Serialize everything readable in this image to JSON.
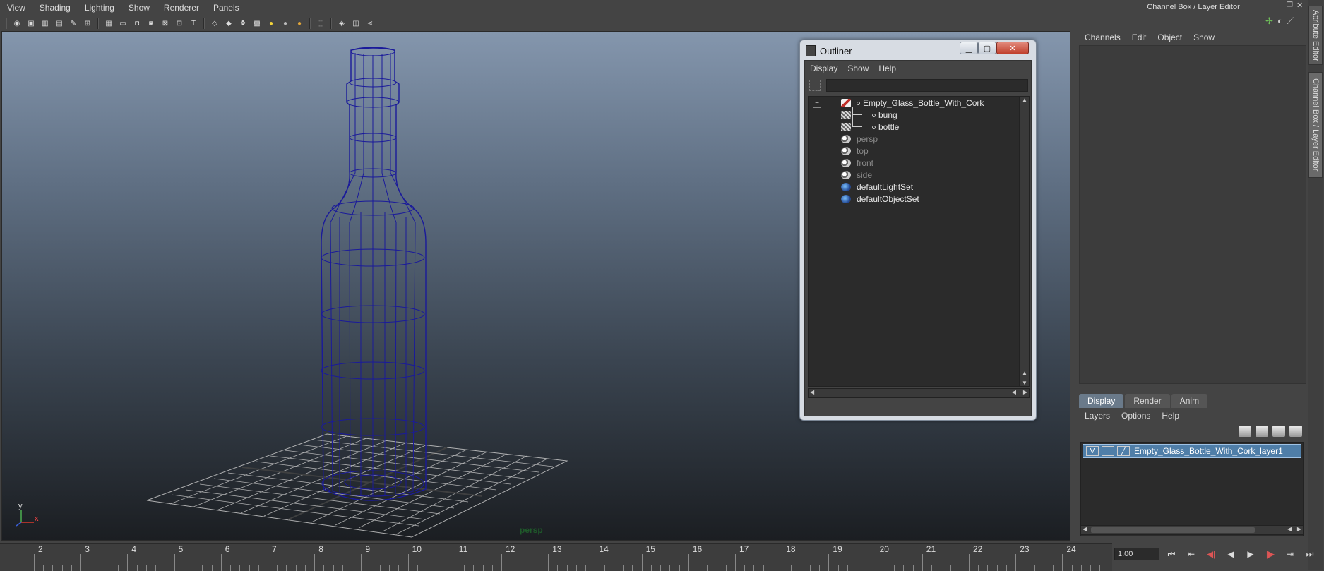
{
  "viewport": {
    "menu": [
      "View",
      "Shading",
      "Lighting",
      "Show",
      "Renderer",
      "Panels"
    ],
    "camera_label": "persp",
    "axis": {
      "y": "y",
      "x": "x"
    }
  },
  "outliner": {
    "title": "Outliner",
    "menu": [
      "Display",
      "Show",
      "Help"
    ],
    "items": [
      {
        "label": "Empty_Glass_Bottle_With_Cork",
        "icon": "group-icon"
      },
      {
        "label": "bung",
        "icon": "mesh-icon"
      },
      {
        "label": "bottle",
        "icon": "mesh-icon"
      },
      {
        "label": "persp",
        "icon": "camera-icon"
      },
      {
        "label": "top",
        "icon": "camera-icon"
      },
      {
        "label": "front",
        "icon": "camera-icon"
      },
      {
        "label": "side",
        "icon": "camera-icon"
      },
      {
        "label": "defaultLightSet",
        "icon": "set-icon"
      },
      {
        "label": "defaultObjectSet",
        "icon": "set-icon"
      }
    ]
  },
  "channel_box": {
    "title": "Channel Box / Layer Editor",
    "menu": [
      "Channels",
      "Edit",
      "Object",
      "Show"
    ]
  },
  "side_tabs": [
    "Attribute Editor",
    "Channel Box / Layer Editor"
  ],
  "layer_editor": {
    "tabs": [
      "Display",
      "Render",
      "Anim"
    ],
    "menu": [
      "Layers",
      "Options",
      "Help"
    ],
    "layer": {
      "visible": "V",
      "name": "Empty_Glass_Bottle_With_Cork_layer1"
    }
  },
  "timeline": {
    "ticks": [
      "2",
      "3",
      "4",
      "5",
      "6",
      "7",
      "8",
      "9",
      "10",
      "11",
      "12",
      "13",
      "14",
      "15",
      "16",
      "17",
      "18",
      "19",
      "20",
      "21",
      "22",
      "23",
      "24"
    ],
    "current_frame": "1.00"
  },
  "colors": {
    "wireframe": "#14148c",
    "layer_selected": "#4f7ea8"
  }
}
